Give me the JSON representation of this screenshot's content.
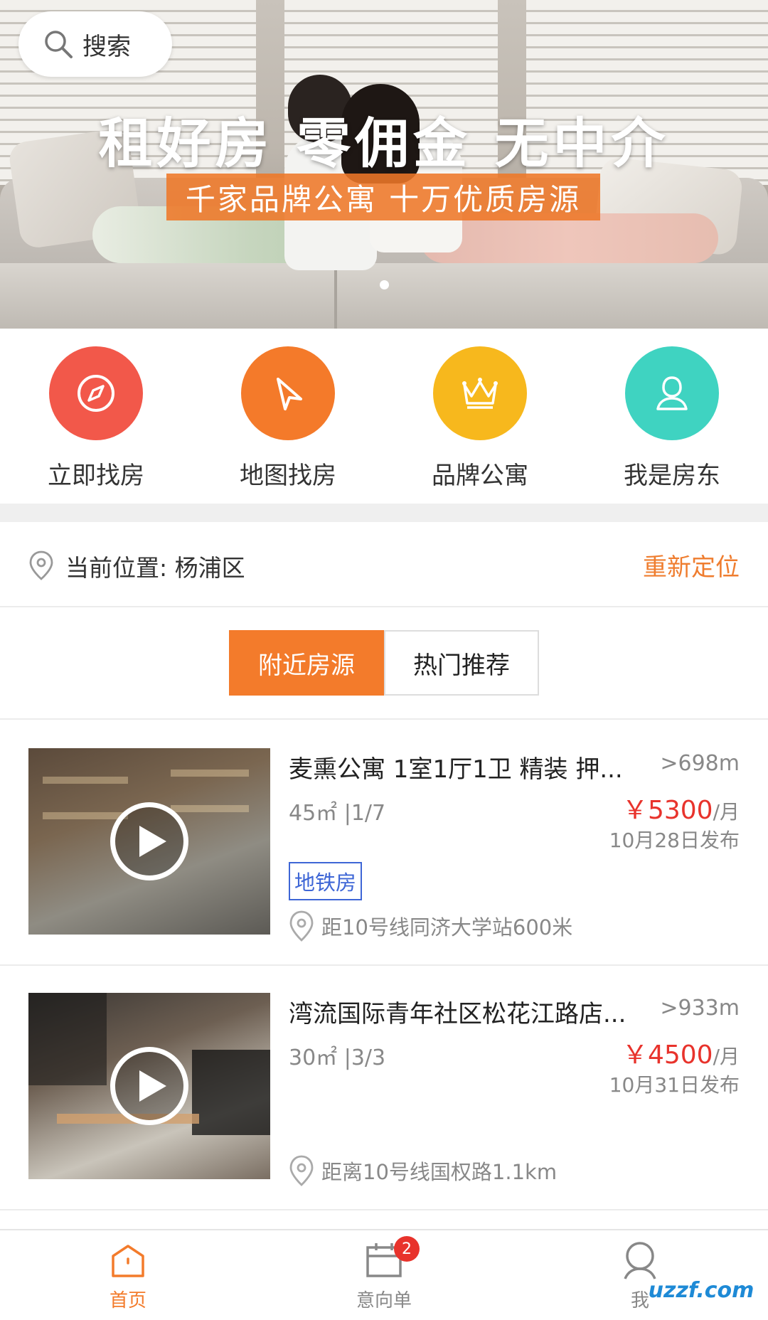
{
  "colors": {
    "accent": "#f37b2b",
    "price": "#e8332c",
    "tag": "#3e66d6",
    "muted": "#888888"
  },
  "banner": {
    "search_label": "搜索",
    "headline": "租好房 零佣金 无中介",
    "subline": "千家品牌公寓 十万优质房源"
  },
  "quick_actions": [
    {
      "label": "立即找房",
      "icon": "compass-icon",
      "color": "#f2584a"
    },
    {
      "label": "地图找房",
      "icon": "navigation-arrow-icon",
      "color": "#f47a2a"
    },
    {
      "label": "品牌公寓",
      "icon": "crown-icon",
      "color": "#f7b81d"
    },
    {
      "label": "我是房东",
      "icon": "user-icon",
      "color": "#3fd3c1"
    }
  ],
  "location": {
    "label": "当前位置: 杨浦区",
    "relocate": "重新定位"
  },
  "tabs": [
    {
      "label": "附近房源",
      "active": true
    },
    {
      "label": "热门推荐",
      "active": false
    }
  ],
  "listings": [
    {
      "title": "麦熏公寓 1室1厅1卫 精装 押...",
      "distance": ">698m",
      "area_floor": "45㎡ |1/7",
      "price": "￥5300",
      "unit": "/月",
      "date": "10月28日发布",
      "tag": "地铁房",
      "location": "距10号线同济大学站600米"
    },
    {
      "title": "湾流国际青年社区松花江路店...",
      "distance": ">933m",
      "area_floor": "30㎡ |3/3",
      "price": "￥4500",
      "unit": "/月",
      "date": "10月31日发布",
      "tag": "",
      "location": "距离10号线国权路1.1km"
    }
  ],
  "bottom_nav": [
    {
      "label": "首页",
      "icon": "home-icon",
      "active": true
    },
    {
      "label": "意向单",
      "icon": "calendar-icon",
      "active": false,
      "badge": "2"
    },
    {
      "label": "我",
      "icon": "profile-icon",
      "active": false
    }
  ],
  "watermark": "uzzf.com"
}
